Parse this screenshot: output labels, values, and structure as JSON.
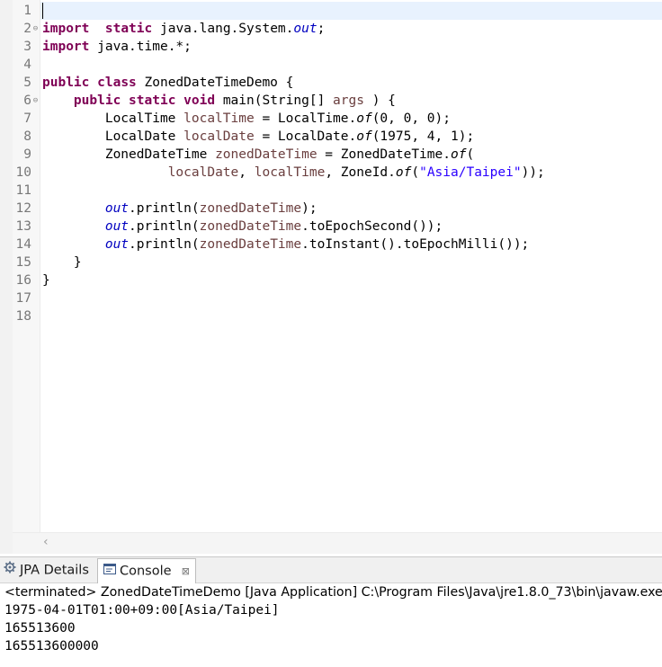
{
  "editor": {
    "lines": [
      {
        "n": "1",
        "fold": ""
      },
      {
        "n": "2",
        "fold": "⊖"
      },
      {
        "n": "3",
        "fold": ""
      },
      {
        "n": "4",
        "fold": ""
      },
      {
        "n": "5",
        "fold": ""
      },
      {
        "n": "6",
        "fold": "⊖"
      },
      {
        "n": "7",
        "fold": ""
      },
      {
        "n": "8",
        "fold": ""
      },
      {
        "n": "9",
        "fold": ""
      },
      {
        "n": "10",
        "fold": ""
      },
      {
        "n": "11",
        "fold": ""
      },
      {
        "n": "12",
        "fold": ""
      },
      {
        "n": "13",
        "fold": ""
      },
      {
        "n": "14",
        "fold": ""
      },
      {
        "n": "15",
        "fold": ""
      },
      {
        "n": "16",
        "fold": ""
      },
      {
        "n": "17",
        "fold": ""
      },
      {
        "n": "18",
        "fold": ""
      }
    ],
    "code": [
      [],
      [
        [
          "kw",
          "import"
        ],
        [
          "",
          "  "
        ],
        [
          "kw",
          "static"
        ],
        [
          "",
          " java.lang.System."
        ],
        [
          "fld",
          "out"
        ],
        [
          "",
          ";"
        ]
      ],
      [
        [
          "kw",
          "import"
        ],
        [
          "",
          " java.time.*;"
        ]
      ],
      [],
      [
        [
          "kw",
          "public"
        ],
        [
          "",
          " "
        ],
        [
          "kw",
          "class"
        ],
        [
          "",
          " ZonedDateTimeDemo {"
        ]
      ],
      [
        [
          "",
          "    "
        ],
        [
          "kw",
          "public"
        ],
        [
          "",
          " "
        ],
        [
          "kw",
          "static"
        ],
        [
          "",
          " "
        ],
        [
          "kw",
          "void"
        ],
        [
          "",
          " main(String[] "
        ],
        [
          "var",
          "args"
        ],
        [
          "",
          " ) {"
        ]
      ],
      [
        [
          "",
          "        LocalTime "
        ],
        [
          "var",
          "localTime"
        ],
        [
          "",
          " = LocalTime."
        ],
        [
          "sm",
          "of"
        ],
        [
          "",
          "(0, 0, 0);"
        ]
      ],
      [
        [
          "",
          "        LocalDate "
        ],
        [
          "var",
          "localDate"
        ],
        [
          "",
          " = LocalDate."
        ],
        [
          "sm",
          "of"
        ],
        [
          "",
          "(1975, 4, 1);"
        ]
      ],
      [
        [
          "",
          "        ZonedDateTime "
        ],
        [
          "var",
          "zonedDateTime"
        ],
        [
          "",
          " = ZonedDateTime."
        ],
        [
          "sm",
          "of"
        ],
        [
          "",
          "("
        ]
      ],
      [
        [
          "",
          "                "
        ],
        [
          "var",
          "localDate"
        ],
        [
          "",
          ", "
        ],
        [
          "var",
          "localTime"
        ],
        [
          "",
          ", ZoneId."
        ],
        [
          "sm",
          "of"
        ],
        [
          "",
          "("
        ],
        [
          "str",
          "\"Asia/Taipei\""
        ],
        [
          "",
          "));"
        ]
      ],
      [],
      [
        [
          "",
          "        "
        ],
        [
          "fld",
          "out"
        ],
        [
          "",
          ".println("
        ],
        [
          "var",
          "zonedDateTime"
        ],
        [
          "",
          ");"
        ]
      ],
      [
        [
          "",
          "        "
        ],
        [
          "fld",
          "out"
        ],
        [
          "",
          ".println("
        ],
        [
          "var",
          "zonedDateTime"
        ],
        [
          "",
          ".toEpochSecond());"
        ]
      ],
      [
        [
          "",
          "        "
        ],
        [
          "fld",
          "out"
        ],
        [
          "",
          ".println("
        ],
        [
          "var",
          "zonedDateTime"
        ],
        [
          "",
          ".toInstant().toEpochMilli());"
        ]
      ],
      [
        [
          "",
          "    }"
        ]
      ],
      [
        [
          "",
          "}"
        ]
      ],
      [],
      []
    ]
  },
  "panel": {
    "tabs": [
      {
        "label": "JPA Details",
        "icon": "gear-icon"
      },
      {
        "label": "Console",
        "icon": "console-icon",
        "close": "⊠"
      }
    ],
    "status": "<terminated> ZonedDateTimeDemo [Java Application] C:\\Program Files\\Java\\jre1.8.0_73\\bin\\javaw.exe",
    "output": [
      "1975-04-01T01:00+09:00[Asia/Taipei]",
      "165513600",
      "165513600000"
    ]
  },
  "colors": {
    "keyword": "#7f0055",
    "field": "#0000c0",
    "variable": "#6a3e3e",
    "string": "#2a00ff",
    "current_line": "#e8f2fe"
  }
}
